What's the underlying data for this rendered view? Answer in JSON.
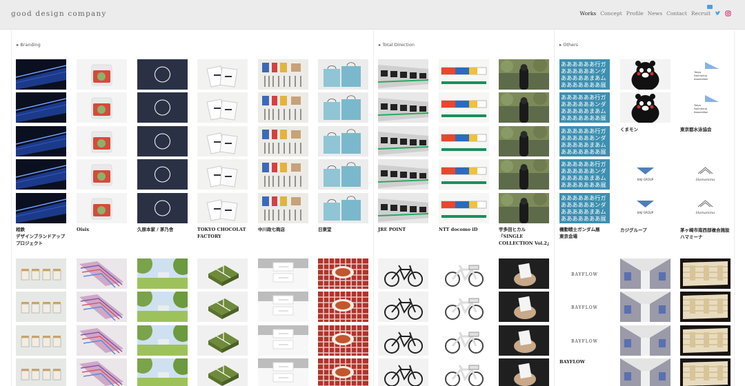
{
  "site": {
    "logo": "good design company"
  },
  "nav": [
    {
      "label": "Works",
      "active": true
    },
    {
      "label": "Concept"
    },
    {
      "label": "Profile"
    },
    {
      "label": "News"
    },
    {
      "label": "Contact"
    },
    {
      "label": "Recruit"
    }
  ],
  "social": [
    "twitter-icon",
    "instagram-icon"
  ],
  "sections": [
    {
      "title": "▸ Branding"
    },
    {
      "title": "▸ Total Direction"
    },
    {
      "title": "▸ Others"
    }
  ],
  "works_row1": [
    {
      "caption": "相鉄\nデザインブランドアップ\nプロジェクト",
      "thumb": "train-dark",
      "count": 5
    },
    {
      "caption": "Oisix",
      "thumb": "bag-red",
      "count": 5
    },
    {
      "caption": "久原本家 / 茅乃舎",
      "thumb": "circle-navy",
      "count": 5
    },
    {
      "caption": "TOKYO CHOCOLAT\nFACTORY",
      "thumb": "bags-white",
      "count": 5
    },
    {
      "caption": "中川政七商店",
      "thumb": "utensils",
      "count": 5
    },
    {
      "caption": "日東堂",
      "thumb": "bags-blue",
      "count": 5
    },
    {
      "caption": "JRE POINT",
      "thumb": "train-bw",
      "count": 5
    },
    {
      "caption": "NTT docomo iD",
      "thumb": "station",
      "count": 5
    },
    {
      "caption": "宇多田ヒカル\n「SINGLE\nCOLLECTION Vol.2」",
      "thumb": "forest",
      "count": 5
    },
    {
      "caption": "機動戦士ガンダム展\n東京会場",
      "thumb": "text-blue",
      "count": 5
    },
    {
      "caption": "くまモン",
      "thumb": "kumamon",
      "count": 2
    },
    {
      "caption": "東京都水泳協会",
      "thumb": "swim",
      "count": 2
    }
  ],
  "works_row1_extra": [
    {
      "caption": "カジグループ",
      "thumb": "kaji",
      "count": 2
    },
    {
      "caption": "茅ヶ崎市南西部複合施設\nハマミーナ",
      "thumb": "hamamina",
      "count": 2
    }
  ],
  "works_row2": [
    {
      "thumb": "cups",
      "count": 4
    },
    {
      "thumb": "books",
      "count": 4
    },
    {
      "thumb": "park",
      "count": 4
    },
    {
      "thumb": "gift-green",
      "count": 4
    },
    {
      "thumb": "cards",
      "count": 4
    },
    {
      "thumb": "table-red",
      "count": 4
    },
    {
      "thumb": "bike-black",
      "count": 4
    },
    {
      "thumb": "bike-white",
      "count": 4
    },
    {
      "thumb": "hands",
      "count": 4
    },
    {
      "caption": "BAYFLOW",
      "thumb": "bayflow",
      "count": 3,
      "logo_text": "BAYFLOW"
    },
    {
      "thumb": "mall",
      "count": 4
    },
    {
      "thumb": "gallery",
      "count": 4
    }
  ],
  "thumb_texts": {
    "gundam": "ああああああ行ガ\nああああああンダ\nあああああまあム\nあああああああ展",
    "kaji": "KAJI GROUP",
    "hamamina": "Hamamina",
    "swim": "Tokyo Swimming Association"
  },
  "colors": {
    "header_bg": "#ececec",
    "gundam_bg": "#3d8fb0"
  }
}
